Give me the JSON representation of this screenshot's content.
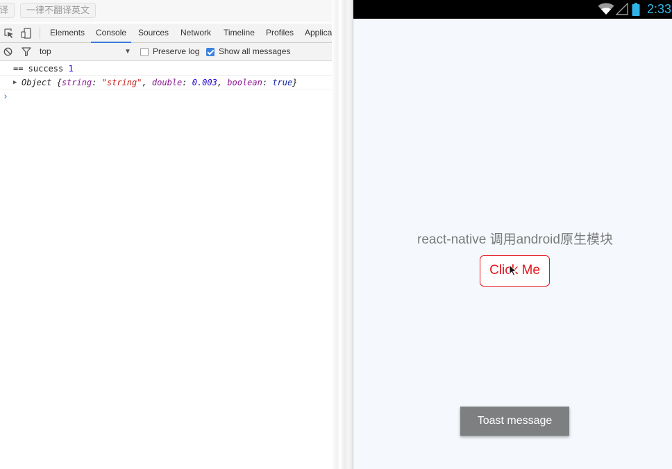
{
  "translate_bar": {
    "translate_label": "译",
    "never_translate_label": "一律不翻译英文"
  },
  "devtools": {
    "tabs": [
      {
        "label": "Elements",
        "active": false
      },
      {
        "label": "Console",
        "active": true
      },
      {
        "label": "Sources",
        "active": false
      },
      {
        "label": "Network",
        "active": false
      },
      {
        "label": "Timeline",
        "active": false
      },
      {
        "label": "Profiles",
        "active": false
      },
      {
        "label": "Application",
        "active": false
      }
    ],
    "accent_color": "#3879d9",
    "console_toolbar": {
      "context": "top",
      "preserve_log": {
        "label": "Preserve log",
        "checked": false
      },
      "show_all": {
        "label": "Show all messages",
        "checked": true
      }
    },
    "console": {
      "line1": {
        "text": "== success",
        "number": "1"
      },
      "line2": {
        "object_name": "Object",
        "open": "{",
        "k1": "string",
        "v1": "\"string\"",
        "k2": "double",
        "v2": "0.003",
        "k3": "boolean",
        "v3": "true",
        "close": "}"
      },
      "prompt": "›"
    }
  },
  "android": {
    "status_time": "2:33",
    "status_time_color": "#35b6e8",
    "heading": "react-native 调用android原生模块",
    "button_label": "Click Me",
    "button_color": "#e8121a",
    "toast": "Toast message",
    "icons": [
      "wifi-icon",
      "signal-icon",
      "battery-icon",
      "mouse-cursor-icon"
    ]
  }
}
